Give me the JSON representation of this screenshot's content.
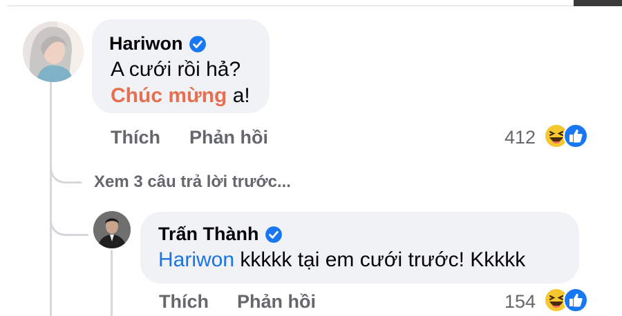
{
  "comments": [
    {
      "author": "Hariwon",
      "verified": true,
      "text_line1": "A cưới rồi hả?",
      "text_line2_highlight": "Chúc mừng",
      "text_line2_rest": " a!",
      "actions": {
        "like": "Thích",
        "reply": "Phản hồi"
      },
      "reaction_count": "412",
      "reactions": [
        "haha-icon",
        "like-icon"
      ]
    }
  ],
  "view_more": "Xem 3 câu trả lời trước...",
  "reply": {
    "author": "Trấn Thành",
    "verified": true,
    "mention": "Hariwon",
    "text": " kkkkk tại em cưới trước! Kkkkk",
    "actions": {
      "like": "Thích",
      "reply": "Phản hồi"
    },
    "reaction_count": "154",
    "reactions": [
      "haha-icon",
      "like-icon"
    ]
  },
  "colors": {
    "bubble": "#f0f2f5",
    "verified_blue": "#1877f2",
    "mention_blue": "#1b74e4",
    "highlight_coral": "#e76f51",
    "meta_gray": "#65676b"
  }
}
